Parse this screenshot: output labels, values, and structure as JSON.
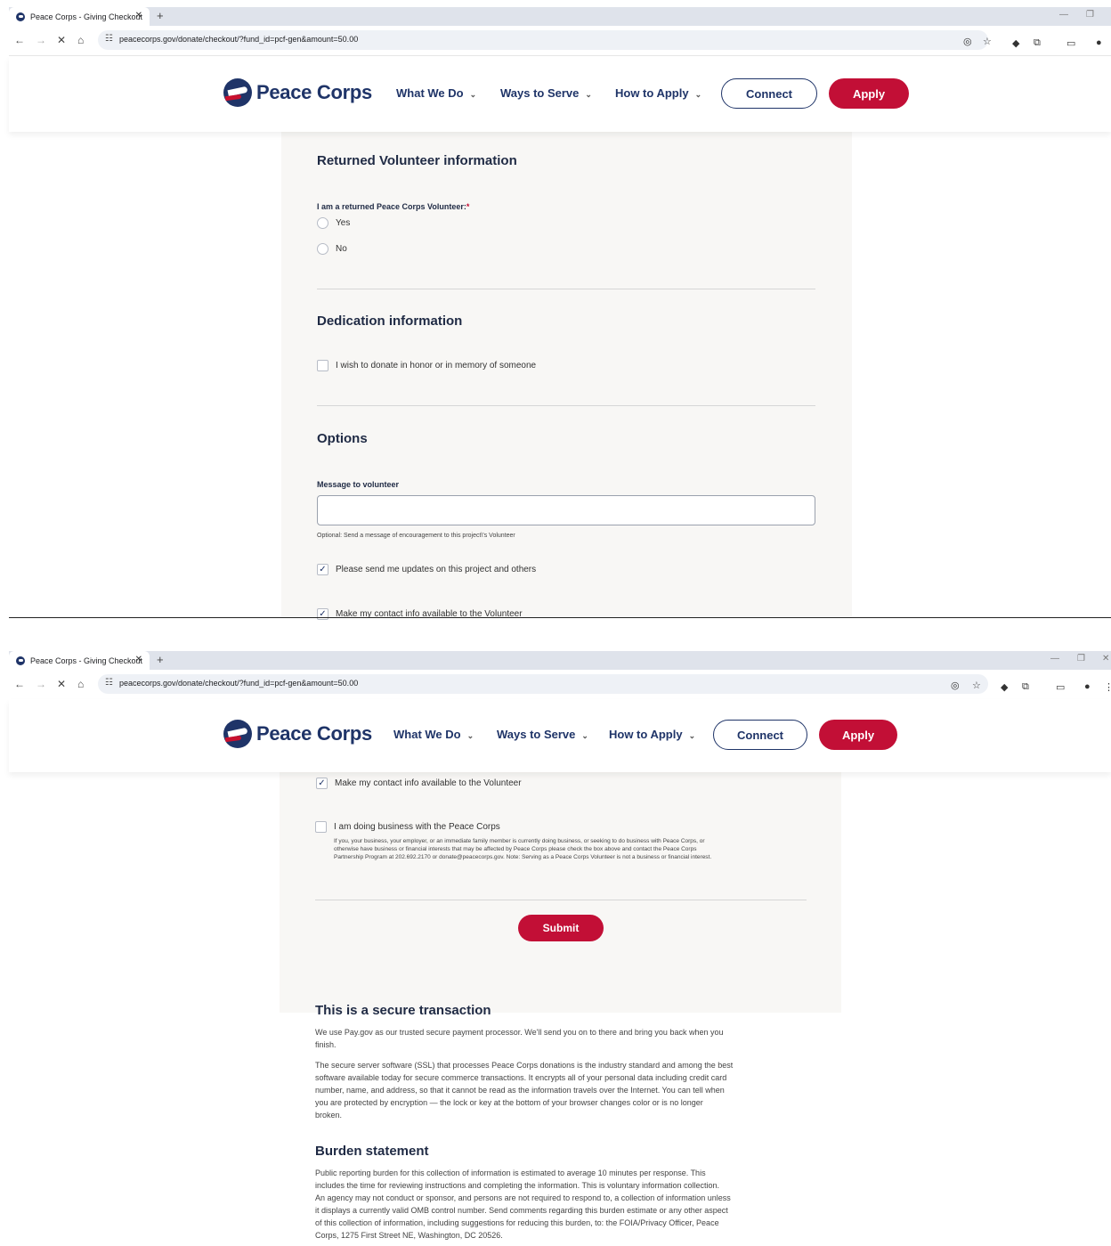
{
  "browser": {
    "tab_title": "Peace Corps - Giving Checkout",
    "tab_close": "✕",
    "new_tab": "+",
    "url": "peacecorps.gov/donate/checkout/?fund_id=pcf-gen&amount=50.00",
    "icons": [
      "back-icon",
      "forward-icon",
      "stop-icon",
      "home-icon",
      "site-settings-icon",
      "eye-off-icon",
      "star-icon",
      "extension-icon",
      "puzzle-icon",
      "reading-list-icon",
      "profile-icon",
      "menu-icon"
    ]
  },
  "header": {
    "logo_text": "Peace Corps",
    "nav": [
      "What We Do",
      "Ways to Serve",
      "How to Apply"
    ],
    "connect_label": "Connect",
    "apply_label": "Apply"
  },
  "returned": {
    "heading": "Returned Volunteer information",
    "question": "I am a returned Peace Corps Volunteer:",
    "required_mark": "*",
    "options": [
      "Yes",
      "No"
    ]
  },
  "dedication": {
    "heading": "Dedication information",
    "checkbox_label": "I wish to donate in honor or in memory of someone"
  },
  "options": {
    "heading": "Options",
    "message_label": "Message to volunteer",
    "message_value": "",
    "message_help": "Optional: Send a message of encouragement to this project\\'s Volunteer",
    "updates_label": "Please send me updates on this project and others",
    "contact_label": "Make my contact info available to the Volunteer",
    "business_label": "I am doing business with the Peace Corps",
    "business_help_1": "If you, your business, your employer, or an immediate family member is currently doing business, or seeking to do business with Peace Corps, or",
    "business_help_2": "otherwise have business or financial interests that may be affected by Peace Corps please check the box above and contact the Peace Corps",
    "business_help_3": "Partnership Program at 202.692.2170 or donate@peacecorps.gov. Note: Serving as a Peace Corps Volunteer is not a business or financial interest."
  },
  "submit_label": "Submit",
  "secure": {
    "heading": "This is a secure transaction",
    "p1_1": "We use Pay.gov as our trusted secure payment processor. We'll send you on to there and bring you back when you",
    "p1_2": "finish.",
    "p2_1": "The secure server software (SSL) that processes Peace Corps donations is the industry standard and among the best",
    "p2_2": "software available today for secure commerce transactions. It encrypts all of your personal data including credit card",
    "p2_3": "number, name, and address, so that it cannot be read as the information travels over the Internet. You can tell when",
    "p2_4": "you are protected by encryption — the lock or key at the bottom of your browser changes color or is no longer",
    "p2_5": "broken."
  },
  "burden": {
    "heading": "Burden statement",
    "l1": "Public reporting burden for this collection of information is estimated to average 10 minutes per response. This",
    "l2": "includes the time for reviewing instructions and completing the information. This is voluntary information collection.",
    "l3": "An agency may not conduct or sponsor, and persons are not required to respond to, a collection of information unless",
    "l4": "it displays a currently valid OMB control number. Send comments regarding this burden estimate or any other aspect",
    "l5": "of this collection of information, including suggestions for reducing this burden, to: the FOIA/Privacy Officer, Peace",
    "l6": "Corps, 1275 First Street NE, Washington, DC 20526."
  },
  "colors": {
    "brand_navy": "#1f3468",
    "brand_red": "#c20f36",
    "panel_bg": "#f8f7f5"
  }
}
